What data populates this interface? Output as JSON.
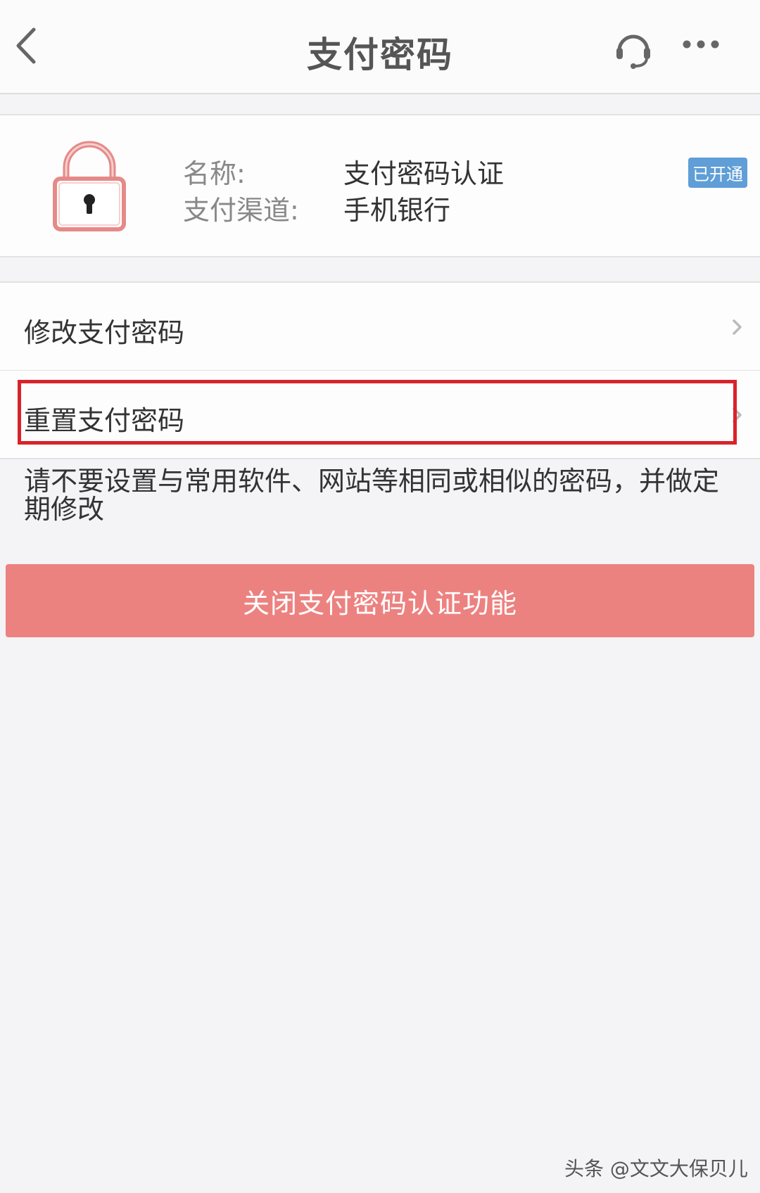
{
  "header": {
    "title": "支付密码",
    "back_icon": "chevron-left-icon",
    "service_icon": "headset-icon",
    "more_icon": "more-dots-icon"
  },
  "info": {
    "icon": "lock-icon",
    "name_label": "名称:",
    "name_value": "支付密码认证",
    "channel_label": "支付渠道:",
    "channel_value": "手机银行",
    "status": "已开通"
  },
  "menu": {
    "items": [
      {
        "label": "修改支付密码"
      },
      {
        "label": "重置支付密码"
      }
    ]
  },
  "notice": "请不要设置与常用软件、网站等相同或相似的密码，并做定期修改",
  "close_button": "关闭支付密码认证功能",
  "watermark": "头条 @文文大保贝儿",
  "colors": {
    "button_bg": "#ec8280",
    "badge_bg": "#5f9ed6",
    "highlight": "#d9232b",
    "lock": "#e58a88"
  }
}
